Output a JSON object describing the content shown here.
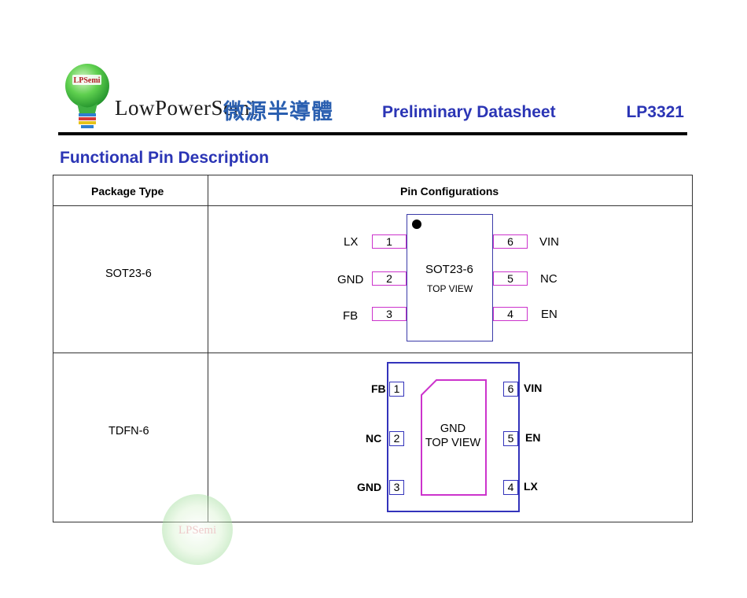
{
  "header": {
    "logo_badge": "LPSemi",
    "brand_name": "LowPowerSemi",
    "brand_cjk": "微源半導體",
    "doc_title": "Preliminary Datasheet",
    "part_number": "LP3321"
  },
  "section": {
    "heading": "Functional Pin Description"
  },
  "table": {
    "headers": [
      "Package Type",
      "Pin Configurations"
    ],
    "rows": [
      {
        "package": "SOT23-6",
        "diagram": {
          "chip_name": "SOT23-6",
          "chip_view": "TOP VIEW",
          "left_pins": [
            {
              "number": "1",
              "name": "LX"
            },
            {
              "number": "2",
              "name": "GND"
            },
            {
              "number": "3",
              "name": "FB"
            }
          ],
          "right_pins": [
            {
              "number": "6",
              "name": "VIN"
            },
            {
              "number": "5",
              "name": "NC"
            },
            {
              "number": "4",
              "name": "EN"
            }
          ]
        }
      },
      {
        "package": "TDFN-6",
        "diagram": {
          "pad_name": "GND",
          "pad_view": "TOP VIEW",
          "left_pins": [
            {
              "number": "1",
              "name": "FB"
            },
            {
              "number": "2",
              "name": "NC"
            },
            {
              "number": "3",
              "name": "GND"
            }
          ],
          "right_pins": [
            {
              "number": "6",
              "name": "VIN"
            },
            {
              "number": "5",
              "name": "EN"
            },
            {
              "number": "4",
              "name": "LX"
            }
          ]
        }
      }
    ]
  },
  "watermark": {
    "text": "LPSemi"
  },
  "colors": {
    "title_blue": "#2b35b5",
    "cjk_blue": "#2a5fb0",
    "pin_magenta": "#cc33cc",
    "outline_blue": "#3333bb",
    "logo_green": "#4cc24a",
    "logo_red": "#b01a20"
  }
}
